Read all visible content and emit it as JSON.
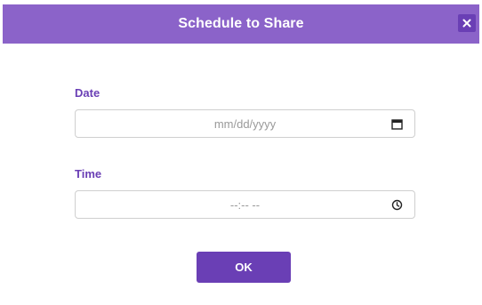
{
  "dialog": {
    "title": "Schedule to Share",
    "close_icon": "close-icon"
  },
  "date_field": {
    "label": "Date",
    "placeholder": "mm/dd/yyyy",
    "icon": "calendar-icon"
  },
  "time_field": {
    "label": "Time",
    "placeholder": "--:-- --",
    "icon": "clock-icon"
  },
  "ok_button": {
    "label": "OK"
  },
  "colors": {
    "header": "#8b63c9",
    "accent": "#6a3fb5"
  }
}
